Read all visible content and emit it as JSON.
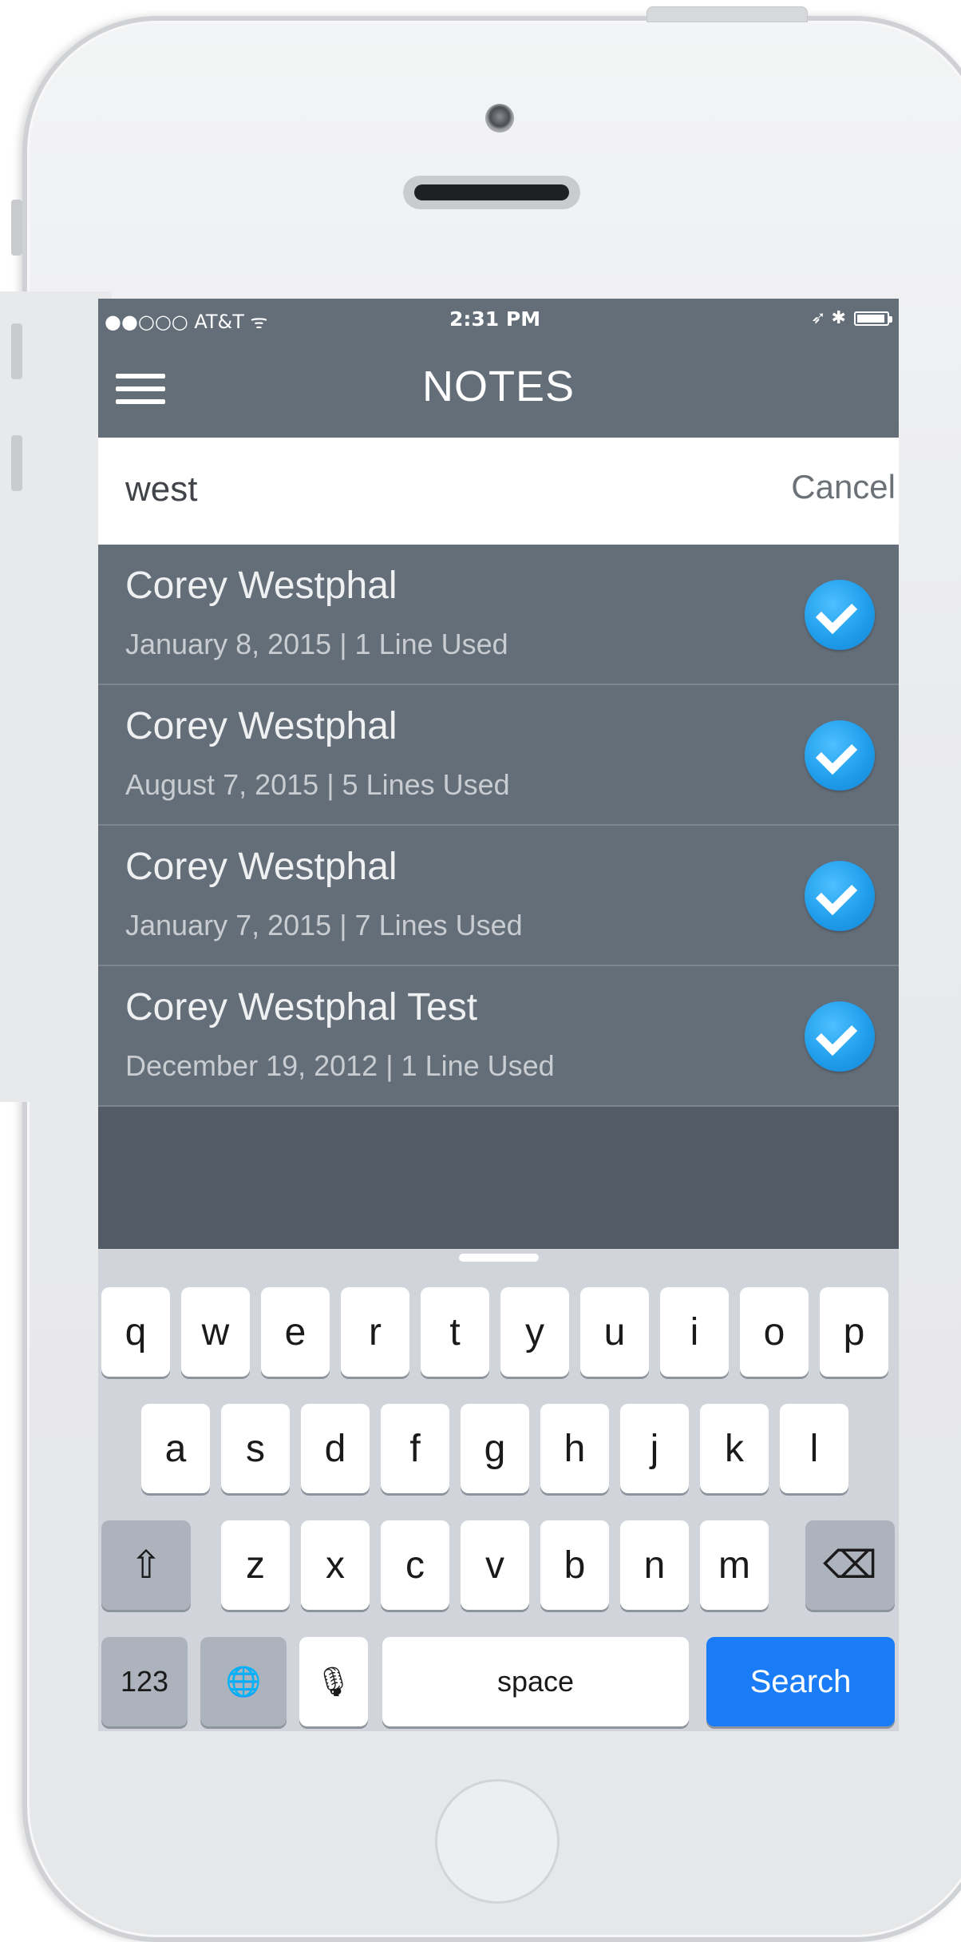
{
  "status_bar": {
    "carrier": "●●○○○ AT&T ᯤ",
    "time": "2:31 PM",
    "indicators": "➶ ✱"
  },
  "nav": {
    "title": "NOTES",
    "menu_icon": "hamburger-menu-icon"
  },
  "search": {
    "value": "west",
    "cancel_label": "Cancel"
  },
  "results": [
    {
      "title": "Corey Westphal",
      "subtitle": "January 8, 2015 | 1 Line Used"
    },
    {
      "title": "Corey Westphal",
      "subtitle": "August 7, 2015 | 5 Lines Used"
    },
    {
      "title": "Corey Westphal",
      "subtitle": "January 7, 2015 | 7 Lines Used"
    },
    {
      "title": "Corey Westphal Test",
      "subtitle": "December 19, 2012 | 1 Line Used"
    }
  ],
  "keyboard": {
    "row1": [
      "q",
      "w",
      "e",
      "r",
      "t",
      "y",
      "u",
      "i",
      "o",
      "p"
    ],
    "row2": [
      "a",
      "s",
      "d",
      "f",
      "g",
      "h",
      "j",
      "k",
      "l"
    ],
    "row3": [
      "z",
      "x",
      "c",
      "v",
      "b",
      "n",
      "m"
    ],
    "numbers_label": "123",
    "space_label": "space",
    "search_label": "Search",
    "shift_icon": "⇧",
    "delete_icon": "⌫",
    "globe_icon": "🌐",
    "mic_icon": "🎙"
  },
  "colors": {
    "accent": "#1a7cf7",
    "nav_bg": "#646e78",
    "check": "#1e9bea"
  }
}
